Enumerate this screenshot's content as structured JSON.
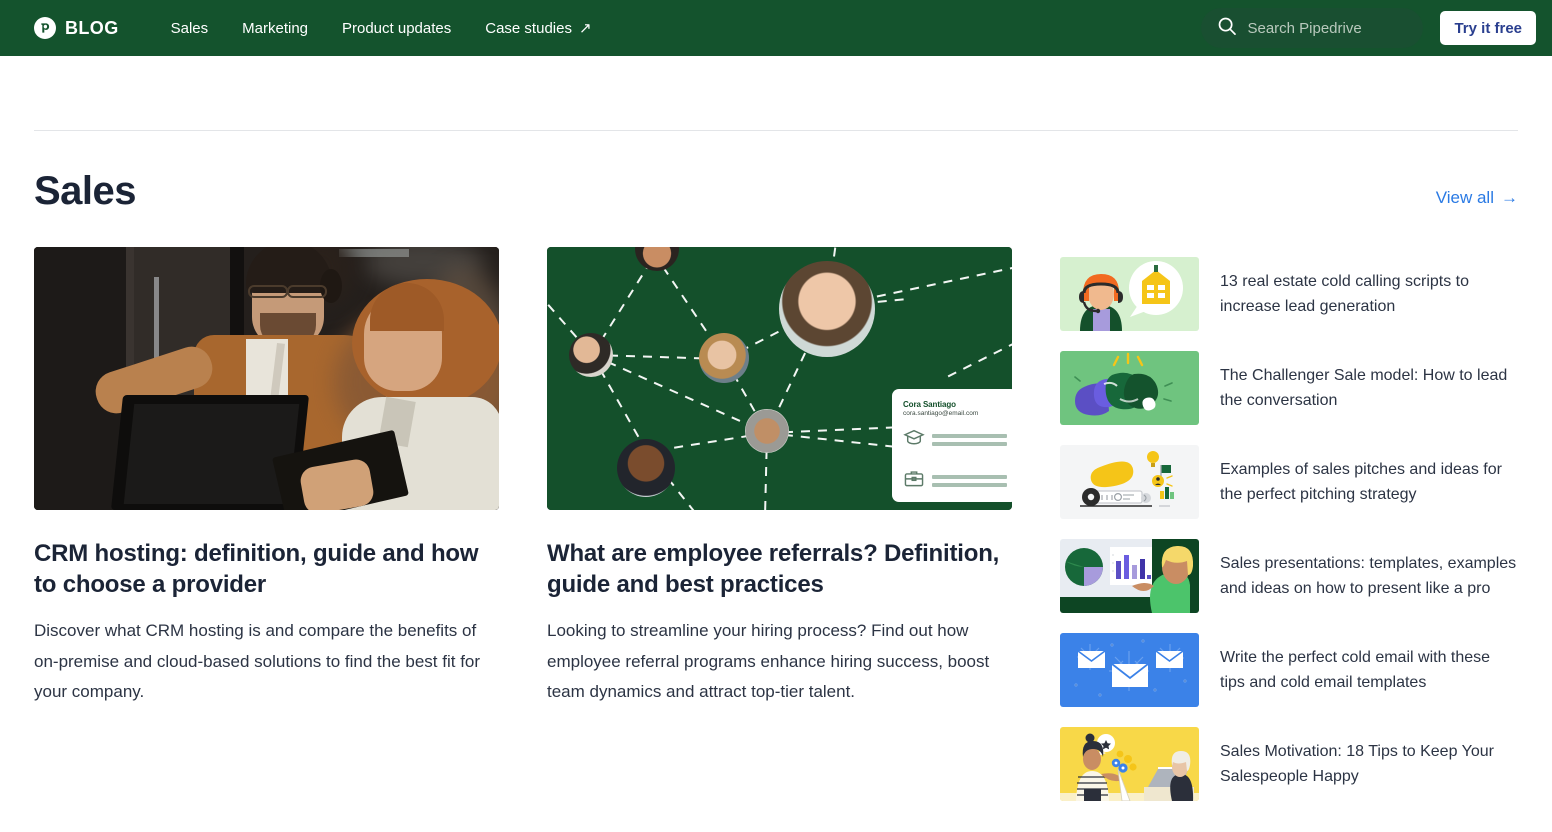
{
  "header": {
    "logo_icon": "pipedrive-p-logo",
    "brand": "BLOG",
    "nav": [
      {
        "label": "Sales",
        "icon": null
      },
      {
        "label": "Marketing",
        "icon": null
      },
      {
        "label": "Product updates",
        "icon": null
      },
      {
        "label": "Case studies",
        "icon": "external-link-arrow"
      }
    ],
    "search": {
      "icon": "search-icon",
      "placeholder": "Search Pipedrive",
      "value": ""
    },
    "cta_label": "Try it free",
    "bg_color": "#14532d",
    "cta_text_color": "#2a3f8f"
  },
  "section": {
    "title": "Sales",
    "view_all_label": "View all",
    "view_all_arrow": "→",
    "link_color": "#2a7ae4"
  },
  "features": [
    {
      "image_alt": "two-colleagues-with-laptop-in-server-room",
      "title": "CRM hosting: definition, guide and how to choose a provider",
      "description": "Discover what CRM hosting is and compare the benefits of on-premise and cloud-based solutions to find the best fit for your company."
    },
    {
      "image_alt": "employee-referral-network-illustration",
      "card_name": "Cora Santiago",
      "card_email": "cora.santiago@email.com",
      "title": "What are employee referrals? Definition, guide and best practices",
      "description": "Looking to streamline your hiring process? Find out how employee referral programs enhance hiring success, boost team dynamics and attract top-tier talent."
    }
  ],
  "side_articles": [
    {
      "title": "13 real estate cold calling scripts to increase lead generation",
      "thumb": "call-agent-house-illustration",
      "thumb_bg": "#d6f0cf"
    },
    {
      "title": "The Challenger Sale model: How to lead the conversation",
      "thumb": "boxing-gloves-illustration",
      "thumb_bg": "#6fc47f"
    },
    {
      "title": "Examples of sales pitches and ideas for the perfect pitching strategy",
      "thumb": "megaphone-gramophone-illustration",
      "thumb_bg": "#f4f5f6"
    },
    {
      "title": "Sales presentations: templates, examples and ideas on how to present like a pro",
      "thumb": "presentation-charts-illustration",
      "thumb_bg": "#0d5a28"
    },
    {
      "title": "Write the perfect cold email with these tips and cold email templates",
      "thumb": "cold-email-envelopes-illustration",
      "thumb_bg": "#3b82e8"
    },
    {
      "title": "Sales Motivation: 18 Tips to Keep Your Salespeople Happy",
      "thumb": "office-flowers-illustration",
      "thumb_bg": "#f8d848"
    }
  ]
}
